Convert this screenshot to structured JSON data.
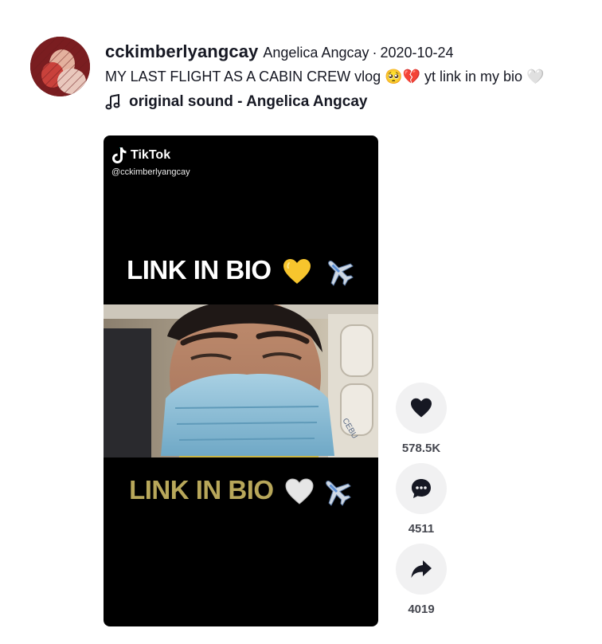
{
  "post": {
    "username": "cckimberlyangcay",
    "nickname": "Angelica Angcay",
    "separator": "·",
    "date": "2020-10-24",
    "caption": "MY LAST FLIGHT AS A CABIN CREW vlog 🥺💔 yt link in my bio 🤍",
    "music": "original sound - Angelica Angcay",
    "music_icon": "music-note-icon"
  },
  "video": {
    "watermark_brand": "TikTok",
    "watermark_handle": "@cckimberlyangcay",
    "overlay_top": "LINK IN BIO",
    "overlay_bottom": "LINK IN BIO",
    "overlay_bottom_color": "#b8a75a"
  },
  "actions": {
    "likes": "578.5K",
    "comments": "4511",
    "shares": "4019",
    "like_icon": "heart-icon",
    "comment_icon": "comment-icon",
    "share_icon": "share-icon"
  },
  "colors": {
    "text": "#161823",
    "action_bg": "#f1f1f2",
    "video_bg": "#000000"
  }
}
